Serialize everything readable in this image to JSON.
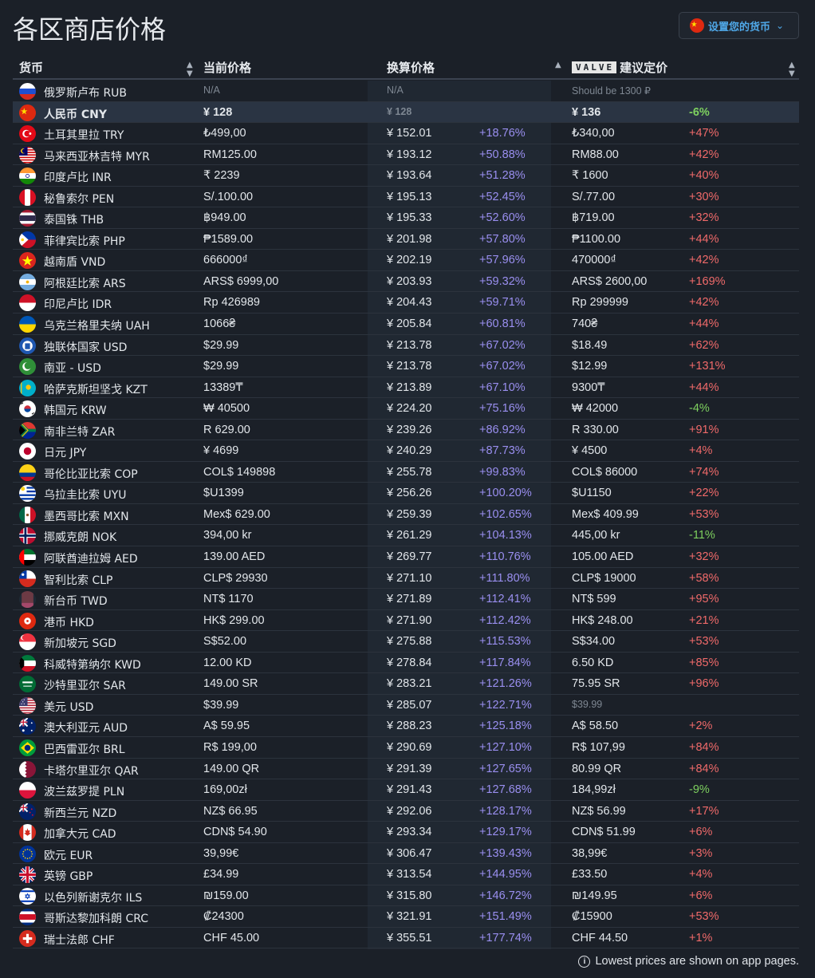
{
  "page_title": "各区商店价格",
  "currency_button": {
    "label": "设置您的货币",
    "flag": "cn"
  },
  "columns": {
    "currency": "货币",
    "current": "当前价格",
    "converted": "换算价格",
    "valve_badge": "VALVE",
    "suggested": "建议定价"
  },
  "footer": "Lowest prices are shown on app pages.",
  "rows": [
    {
      "flag": "ru",
      "name": "俄罗斯卢布 RUB",
      "current": "N/A",
      "converted": "N/A",
      "diff": "",
      "suggested": "Should be 1300 ₽",
      "sdiff": "",
      "dimCur": true,
      "dimConv": true,
      "dimSug": true
    },
    {
      "flag": "cn",
      "name": "人民币 CNY",
      "current": "¥ 128",
      "converted": "¥ 128",
      "diff": "",
      "suggested": "¥ 136",
      "sdiff": "-6%",
      "highlight": true,
      "dimConv": true
    },
    {
      "flag": "tr",
      "name": "土耳其里拉 TRY",
      "current": "₺499,00",
      "converted": "¥ 152.01",
      "diff": "+18.76%",
      "suggested": "₺340,00",
      "sdiff": "+47%"
    },
    {
      "flag": "my",
      "name": "马来西亚林吉特 MYR",
      "current": "RM125.00",
      "converted": "¥ 193.12",
      "diff": "+50.88%",
      "suggested": "RM88.00",
      "sdiff": "+42%"
    },
    {
      "flag": "in",
      "name": "印度卢比 INR",
      "current": "₹ 2239",
      "converted": "¥ 193.64",
      "diff": "+51.28%",
      "suggested": "₹ 1600",
      "sdiff": "+40%"
    },
    {
      "flag": "pe",
      "name": "秘鲁索尔 PEN",
      "current": "S/.100.00",
      "converted": "¥ 195.13",
      "diff": "+52.45%",
      "suggested": "S/.77.00",
      "sdiff": "+30%"
    },
    {
      "flag": "th",
      "name": "泰国铢 THB",
      "current": "฿949.00",
      "converted": "¥ 195.33",
      "diff": "+52.60%",
      "suggested": "฿719.00",
      "sdiff": "+32%"
    },
    {
      "flag": "ph",
      "name": "菲律宾比索 PHP",
      "current": "₱1589.00",
      "converted": "¥ 201.98",
      "diff": "+57.80%",
      "suggested": "₱1100.00",
      "sdiff": "+44%"
    },
    {
      "flag": "vn",
      "name": "越南盾 VND",
      "current": "666000₫",
      "converted": "¥ 202.19",
      "diff": "+57.96%",
      "suggested": "470000₫",
      "sdiff": "+42%"
    },
    {
      "flag": "ar",
      "name": "阿根廷比索 ARS",
      "current": "ARS$ 6999,00",
      "converted": "¥ 203.93",
      "diff": "+59.32%",
      "suggested": "ARS$ 2600,00",
      "sdiff": "+169%"
    },
    {
      "flag": "id",
      "name": "印尼卢比 IDR",
      "current": "Rp 426989",
      "converted": "¥ 204.43",
      "diff": "+59.71%",
      "suggested": "Rp 299999",
      "sdiff": "+42%"
    },
    {
      "flag": "ua",
      "name": "乌克兰格里夫纳 UAH",
      "current": "1066₴",
      "converted": "¥ 205.84",
      "diff": "+60.81%",
      "suggested": "740₴",
      "sdiff": "+44%"
    },
    {
      "flag": "cis",
      "name": "独联体国家 USD",
      "current": "$29.99",
      "converted": "¥ 213.78",
      "diff": "+67.02%",
      "suggested": "$18.49",
      "sdiff": "+62%"
    },
    {
      "flag": "sa-asia",
      "name": "南亚 - USD",
      "current": "$29.99",
      "converted": "¥ 213.78",
      "diff": "+67.02%",
      "suggested": "$12.99",
      "sdiff": "+131%"
    },
    {
      "flag": "kz",
      "name": "哈萨克斯坦坚戈 KZT",
      "current": "13389₸",
      "converted": "¥ 213.89",
      "diff": "+67.10%",
      "suggested": "9300₸",
      "sdiff": "+44%"
    },
    {
      "flag": "kr",
      "name": "韩国元 KRW",
      "current": "₩ 40500",
      "converted": "¥ 224.20",
      "diff": "+75.16%",
      "suggested": "₩ 42000",
      "sdiff": "-4%"
    },
    {
      "flag": "za",
      "name": "南非兰特 ZAR",
      "current": "R 629.00",
      "converted": "¥ 239.26",
      "diff": "+86.92%",
      "suggested": "R 330.00",
      "sdiff": "+91%"
    },
    {
      "flag": "jp",
      "name": "日元 JPY",
      "current": "¥ 4699",
      "converted": "¥ 240.29",
      "diff": "+87.73%",
      "suggested": "¥ 4500",
      "sdiff": "+4%"
    },
    {
      "flag": "co",
      "name": "哥伦比亚比索 COP",
      "current": "COL$ 149898",
      "converted": "¥ 255.78",
      "diff": "+99.83%",
      "suggested": "COL$ 86000",
      "sdiff": "+74%"
    },
    {
      "flag": "uy",
      "name": "乌拉圭比索 UYU",
      "current": "$U1399",
      "converted": "¥ 256.26",
      "diff": "+100.20%",
      "suggested": "$U1150",
      "sdiff": "+22%"
    },
    {
      "flag": "mx",
      "name": "墨西哥比索 MXN",
      "current": "Mex$ 629.00",
      "converted": "¥ 259.39",
      "diff": "+102.65%",
      "suggested": "Mex$ 409.99",
      "sdiff": "+53%"
    },
    {
      "flag": "no",
      "name": "挪威克朗 NOK",
      "current": "394,00 kr",
      "converted": "¥ 261.29",
      "diff": "+104.13%",
      "suggested": "445,00 kr",
      "sdiff": "-11%"
    },
    {
      "flag": "ae",
      "name": "阿联酋迪拉姆 AED",
      "current": "139.00 AED",
      "converted": "¥ 269.77",
      "diff": "+110.76%",
      "suggested": "105.00 AED",
      "sdiff": "+32%"
    },
    {
      "flag": "cl",
      "name": "智利比索 CLP",
      "current": "CLP$ 29930",
      "converted": "¥ 271.10",
      "diff": "+111.80%",
      "suggested": "CLP$ 19000",
      "sdiff": "+58%"
    },
    {
      "flag": "tw",
      "name": "新台币 TWD",
      "current": "NT$ 1170",
      "converted": "¥ 271.89",
      "diff": "+112.41%",
      "suggested": "NT$ 599",
      "sdiff": "+95%"
    },
    {
      "flag": "hk",
      "name": "港币 HKD",
      "current": "HK$ 299.00",
      "converted": "¥ 271.90",
      "diff": "+112.42%",
      "suggested": "HK$ 248.00",
      "sdiff": "+21%"
    },
    {
      "flag": "sg",
      "name": "新加坡元 SGD",
      "current": "S$52.00",
      "converted": "¥ 275.88",
      "diff": "+115.53%",
      "suggested": "S$34.00",
      "sdiff": "+53%"
    },
    {
      "flag": "kw",
      "name": "科威特第纳尔 KWD",
      "current": "12.00 KD",
      "converted": "¥ 278.84",
      "diff": "+117.84%",
      "suggested": "6.50 KD",
      "sdiff": "+85%"
    },
    {
      "flag": "sa",
      "name": "沙特里亚尔 SAR",
      "current": "149.00 SR",
      "converted": "¥ 283.21",
      "diff": "+121.26%",
      "suggested": "75.95 SR",
      "sdiff": "+96%"
    },
    {
      "flag": "us",
      "name": "美元 USD",
      "current": "$39.99",
      "converted": "¥ 285.07",
      "diff": "+122.71%",
      "suggested": "$39.99",
      "sdiff": "",
      "dimSug": true
    },
    {
      "flag": "au",
      "name": "澳大利亚元 AUD",
      "current": "A$ 59.95",
      "converted": "¥ 288.23",
      "diff": "+125.18%",
      "suggested": "A$ 58.50",
      "sdiff": "+2%"
    },
    {
      "flag": "br",
      "name": "巴西雷亚尔 BRL",
      "current": "R$ 199,00",
      "converted": "¥ 290.69",
      "diff": "+127.10%",
      "suggested": "R$ 107,99",
      "sdiff": "+84%"
    },
    {
      "flag": "qa",
      "name": "卡塔尔里亚尔 QAR",
      "current": "149.00 QR",
      "converted": "¥ 291.39",
      "diff": "+127.65%",
      "suggested": "80.99 QR",
      "sdiff": "+84%"
    },
    {
      "flag": "pl",
      "name": "波兰兹罗提 PLN",
      "current": "169,00zł",
      "converted": "¥ 291.43",
      "diff": "+127.68%",
      "suggested": "184,99zł",
      "sdiff": "-9%"
    },
    {
      "flag": "nz",
      "name": "新西兰元 NZD",
      "current": "NZ$ 66.95",
      "converted": "¥ 292.06",
      "diff": "+128.17%",
      "suggested": "NZ$ 56.99",
      "sdiff": "+17%"
    },
    {
      "flag": "ca",
      "name": "加拿大元 CAD",
      "current": "CDN$ 54.90",
      "converted": "¥ 293.34",
      "diff": "+129.17%",
      "suggested": "CDN$ 51.99",
      "sdiff": "+6%"
    },
    {
      "flag": "eu",
      "name": "欧元 EUR",
      "current": "39,99€",
      "converted": "¥ 306.47",
      "diff": "+139.43%",
      "suggested": "38,99€",
      "sdiff": "+3%"
    },
    {
      "flag": "gb",
      "name": "英镑 GBP",
      "current": "£34.99",
      "converted": "¥ 313.54",
      "diff": "+144.95%",
      "suggested": "£33.50",
      "sdiff": "+4%"
    },
    {
      "flag": "il",
      "name": "以色列新谢克尔 ILS",
      "current": "₪159.00",
      "converted": "¥ 315.80",
      "diff": "+146.72%",
      "suggested": "₪149.95",
      "sdiff": "+6%"
    },
    {
      "flag": "cr",
      "name": "哥斯达黎加科朗 CRC",
      "current": "₡24300",
      "converted": "¥ 321.91",
      "diff": "+151.49%",
      "suggested": "₡15900",
      "sdiff": "+53%"
    },
    {
      "flag": "ch",
      "name": "瑞士法郎 CHF",
      "current": "CHF 45.00",
      "converted": "¥ 355.51",
      "diff": "+177.74%",
      "suggested": "CHF 44.50",
      "sdiff": "+1%"
    }
  ]
}
